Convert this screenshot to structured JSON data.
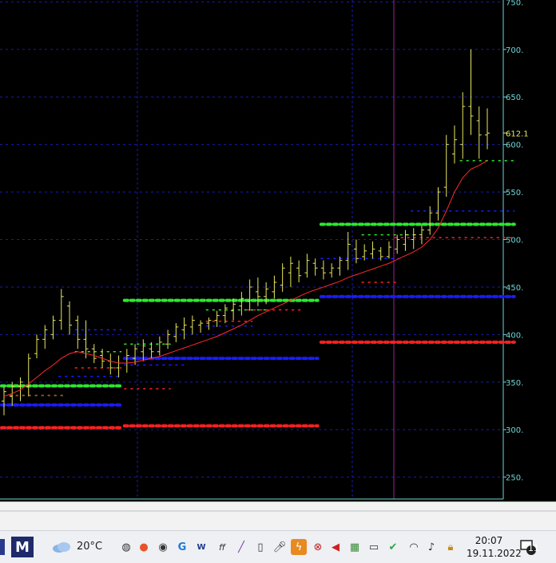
{
  "chart_data": {
    "type": "ohlc",
    "y_ticks": [
      "700.",
      "650.",
      "600.",
      "550.",
      "500.",
      "450.",
      "400.",
      "350.",
      "300.",
      "250."
    ],
    "y_ticks_values": [
      700,
      650,
      600,
      550,
      500,
      450,
      400,
      350,
      300,
      250
    ],
    "top_tick_partial": "750.",
    "ylim": [
      227,
      752
    ],
    "last_price_label": "612.1",
    "last_price": 612.1,
    "grid": true,
    "bars": [
      {
        "h": 345,
        "l": 315,
        "o": 330,
        "c": 340
      },
      {
        "h": 350,
        "l": 325,
        "o": 335,
        "c": 345
      },
      {
        "h": 355,
        "l": 330,
        "o": 345,
        "c": 350
      },
      {
        "h": 380,
        "l": 335,
        "o": 345,
        "c": 375
      },
      {
        "h": 400,
        "l": 375,
        "o": 380,
        "c": 395
      },
      {
        "h": 410,
        "l": 385,
        "o": 395,
        "c": 405
      },
      {
        "h": 420,
        "l": 395,
        "o": 400,
        "c": 415
      },
      {
        "h": 448,
        "l": 405,
        "o": 415,
        "c": 440
      },
      {
        "h": 435,
        "l": 400,
        "o": 430,
        "c": 410
      },
      {
        "h": 420,
        "l": 385,
        "o": 415,
        "c": 395
      },
      {
        "h": 415,
        "l": 375,
        "o": 395,
        "c": 385
      },
      {
        "h": 390,
        "l": 370,
        "o": 385,
        "c": 375
      },
      {
        "h": 385,
        "l": 365,
        "o": 378,
        "c": 372
      },
      {
        "h": 380,
        "l": 358,
        "o": 372,
        "c": 365
      },
      {
        "h": 378,
        "l": 355,
        "o": 365,
        "c": 370
      },
      {
        "h": 385,
        "l": 360,
        "o": 370,
        "c": 378
      },
      {
        "h": 390,
        "l": 368,
        "o": 375,
        "c": 385
      },
      {
        "h": 395,
        "l": 372,
        "o": 382,
        "c": 388
      },
      {
        "h": 392,
        "l": 375,
        "o": 385,
        "c": 382
      },
      {
        "h": 398,
        "l": 378,
        "o": 382,
        "c": 392
      },
      {
        "h": 405,
        "l": 385,
        "o": 390,
        "c": 400
      },
      {
        "h": 412,
        "l": 392,
        "o": 398,
        "c": 408
      },
      {
        "h": 418,
        "l": 395,
        "o": 405,
        "c": 410
      },
      {
        "h": 420,
        "l": 400,
        "o": 408,
        "c": 415
      },
      {
        "h": 415,
        "l": 402,
        "o": 410,
        "c": 412
      },
      {
        "h": 418,
        "l": 405,
        "o": 412,
        "c": 415
      },
      {
        "h": 425,
        "l": 408,
        "o": 415,
        "c": 420
      },
      {
        "h": 432,
        "l": 412,
        "o": 420,
        "c": 428
      },
      {
        "h": 438,
        "l": 415,
        "o": 425,
        "c": 432
      },
      {
        "h": 445,
        "l": 420,
        "o": 430,
        "c": 438
      },
      {
        "h": 458,
        "l": 425,
        "o": 435,
        "c": 450
      },
      {
        "h": 460,
        "l": 430,
        "o": 445,
        "c": 440
      },
      {
        "h": 455,
        "l": 432,
        "o": 440,
        "c": 448
      },
      {
        "h": 462,
        "l": 438,
        "o": 445,
        "c": 455
      },
      {
        "h": 475,
        "l": 445,
        "o": 452,
        "c": 470
      },
      {
        "h": 482,
        "l": 450,
        "o": 465,
        "c": 475
      },
      {
        "h": 478,
        "l": 455,
        "o": 470,
        "c": 462
      },
      {
        "h": 485,
        "l": 460,
        "o": 465,
        "c": 478
      },
      {
        "h": 480,
        "l": 462,
        "o": 475,
        "c": 470
      },
      {
        "h": 478,
        "l": 458,
        "o": 470,
        "c": 465
      },
      {
        "h": 475,
        "l": 460,
        "o": 465,
        "c": 470
      },
      {
        "h": 482,
        "l": 462,
        "o": 470,
        "c": 478
      },
      {
        "h": 508,
        "l": 468,
        "o": 478,
        "c": 495
      },
      {
        "h": 500,
        "l": 475,
        "o": 490,
        "c": 480
      },
      {
        "h": 495,
        "l": 478,
        "o": 482,
        "c": 488
      },
      {
        "h": 498,
        "l": 480,
        "o": 485,
        "c": 490
      },
      {
        "h": 492,
        "l": 478,
        "o": 488,
        "c": 482
      },
      {
        "h": 498,
        "l": 480,
        "o": 482,
        "c": 492
      },
      {
        "h": 505,
        "l": 485,
        "o": 490,
        "c": 500
      },
      {
        "h": 510,
        "l": 488,
        "o": 495,
        "c": 505
      },
      {
        "h": 512,
        "l": 490,
        "o": 500,
        "c": 505
      },
      {
        "h": 515,
        "l": 495,
        "o": 505,
        "c": 510
      },
      {
        "h": 535,
        "l": 505,
        "o": 510,
        "c": 528
      },
      {
        "h": 555,
        "l": 520,
        "o": 528,
        "c": 550
      },
      {
        "h": 610,
        "l": 545,
        "o": 555,
        "c": 600
      },
      {
        "h": 620,
        "l": 580,
        "o": 590,
        "c": 605
      },
      {
        "h": 655,
        "l": 585,
        "o": 600,
        "c": 640
      },
      {
        "h": 700,
        "l": 610,
        "o": 640,
        "c": 630
      },
      {
        "h": 640,
        "l": 585,
        "o": 625,
        "c": 610
      },
      {
        "h": 638,
        "l": 595,
        "o": 610,
        "c": 612
      }
    ],
    "moving_average": [
      335,
      338,
      342,
      348,
      355,
      362,
      368,
      375,
      380,
      382,
      380,
      378,
      375,
      372,
      370,
      370,
      371,
      373,
      375,
      377,
      380,
      383,
      386,
      389,
      392,
      395,
      398,
      402,
      406,
      410,
      415,
      420,
      424,
      428,
      432,
      436,
      440,
      444,
      447,
      450,
      453,
      456,
      460,
      463,
      466,
      469,
      472,
      475,
      479,
      483,
      487,
      492,
      500,
      512,
      530,
      550,
      565,
      574,
      578,
      583
    ],
    "levels": [
      {
        "color": "#2de82d",
        "style": "thick",
        "value": 346,
        "from": 0,
        "to": 14
      },
      {
        "color": "#1a1aff",
        "style": "thick",
        "value": 326,
        "from": 0,
        "to": 14
      },
      {
        "color": "#ff2020",
        "style": "thick",
        "value": 302,
        "from": 0,
        "to": 14
      },
      {
        "color": "#2de82d",
        "style": "thin",
        "value": 336,
        "from": 1,
        "to": 7
      },
      {
        "color": "#ff2020",
        "style": "thin",
        "value": 336,
        "from": 1,
        "to": 7
      },
      {
        "color": "#2de82d",
        "style": "thin",
        "value": 382,
        "from": 9,
        "to": 14
      },
      {
        "color": "#1a1aff",
        "style": "thin",
        "value": 405,
        "from": 9,
        "to": 14
      },
      {
        "color": "#1a1aff",
        "style": "thin",
        "value": 356,
        "from": 7,
        "to": 14
      },
      {
        "color": "#ff2020",
        "style": "thin",
        "value": 365,
        "from": 9,
        "to": 14
      },
      {
        "color": "#2de82d",
        "style": "thick",
        "value": 436,
        "from": 15,
        "to": 38
      },
      {
        "color": "#1a1aff",
        "style": "thick",
        "value": 375,
        "from": 15,
        "to": 38
      },
      {
        "color": "#ff2020",
        "style": "thick",
        "value": 304,
        "from": 15,
        "to": 38
      },
      {
        "color": "#ff2020",
        "style": "thin",
        "value": 343,
        "from": 15,
        "to": 20
      },
      {
        "color": "#2de82d",
        "style": "thin",
        "value": 390,
        "from": 15,
        "to": 20
      },
      {
        "color": "#1a1aff",
        "style": "thin",
        "value": 368,
        "from": 15,
        "to": 22
      },
      {
        "color": "#2de82d",
        "style": "thin",
        "value": 426,
        "from": 25,
        "to": 32
      },
      {
        "color": "#1a1aff",
        "style": "thin",
        "value": 409,
        "from": 25,
        "to": 30
      },
      {
        "color": "#ff2020",
        "style": "thin",
        "value": 426,
        "from": 30,
        "to": 36
      },
      {
        "color": "#ff2020",
        "style": "thin",
        "value": 414,
        "from": 25,
        "to": 30
      },
      {
        "color": "#2de82d",
        "style": "thick",
        "value": 516,
        "from": 39,
        "to": 62
      },
      {
        "color": "#1a1aff",
        "style": "thick",
        "value": 440,
        "from": 39,
        "to": 62
      },
      {
        "color": "#ff2020",
        "style": "thick",
        "value": 392,
        "from": 39,
        "to": 62
      },
      {
        "color": "#1a1aff",
        "style": "thin",
        "value": 480,
        "from": 39,
        "to": 48
      },
      {
        "color": "#ff2020",
        "style": "thin",
        "value": 455,
        "from": 44,
        "to": 48
      },
      {
        "color": "#ff2020",
        "style": "thin",
        "value": 502,
        "from": 48,
        "to": 62
      },
      {
        "color": "#1a1aff",
        "style": "thin",
        "value": 530,
        "from": 50,
        "to": 62
      },
      {
        "color": "#2de82d",
        "style": "thin",
        "value": 583,
        "from": 56,
        "to": 62
      },
      {
        "color": "#2de82d",
        "style": "thin",
        "value": 505,
        "from": 44,
        "to": 50
      }
    ],
    "colors": {
      "background": "#000000",
      "grid": "#1a1ab8",
      "price_bar": "#e8e860",
      "ma_line": "#ff2a2a",
      "axis_text": "#6fd6d6",
      "vertical_marker": "#a020a0",
      "period_divider": "#1a1ab8"
    }
  },
  "taskbar": {
    "weather_temp": "20°C",
    "time": "20:07",
    "date": "19.11.2022",
    "notification_count": "11",
    "icons": [
      "window-edge-icon",
      "malwarebytes-icon",
      "weather-cloud-icon",
      "browser-globe-icon",
      "firefox-icon",
      "obs-icon",
      "refresh-app-icon",
      "wiz-icon",
      "pen-icon",
      "phone-link-icon",
      "microphone-icon",
      "lightning-app-icon",
      "network-error-icon",
      "speaker-red-icon",
      "calendar-app-icon",
      "battery-icon",
      "security-shield-icon",
      "wifi-icon",
      "volume-icon",
      "lock-icon",
      "notifications-icon"
    ]
  }
}
